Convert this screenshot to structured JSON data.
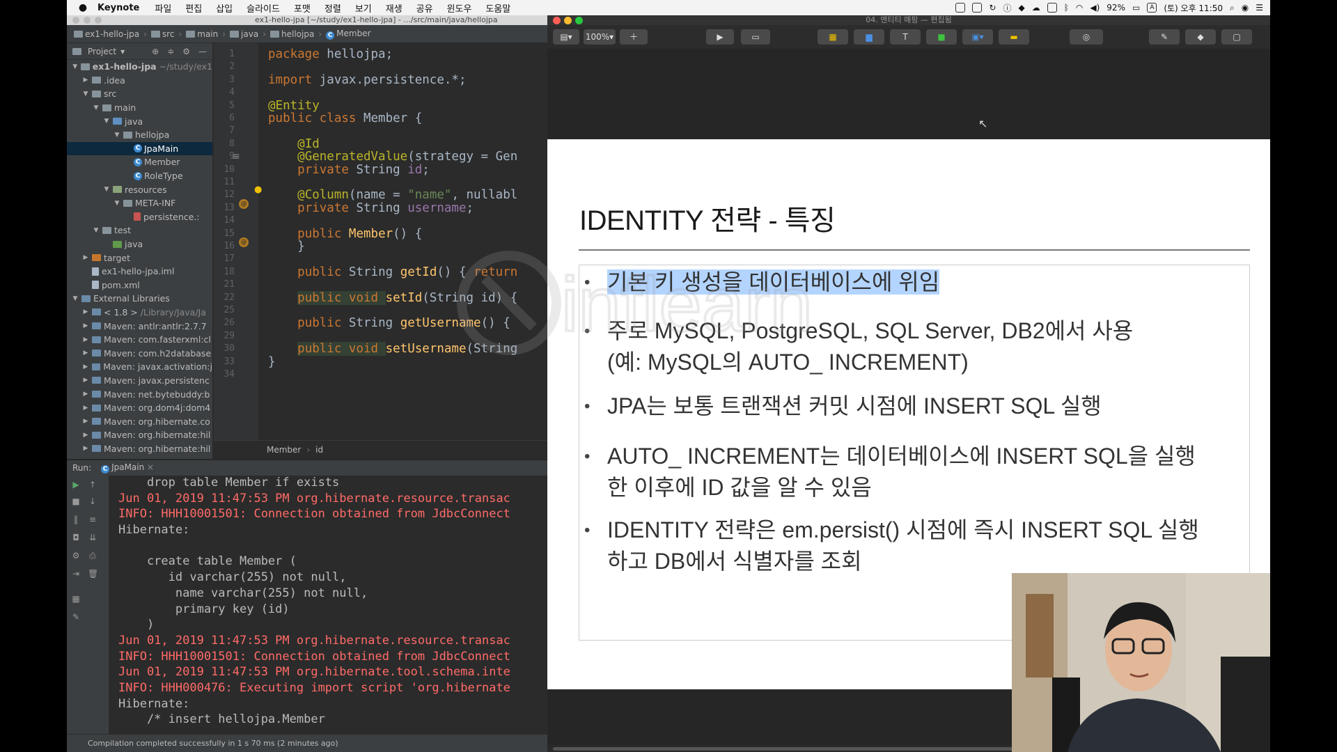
{
  "menubar": {
    "app": "Keynote",
    "items": [
      "파일",
      "편집",
      "삽입",
      "슬라이드",
      "포맷",
      "정렬",
      "보기",
      "재생",
      "공유",
      "윈도우",
      "도움말"
    ],
    "battery": "92%",
    "input_source": "A",
    "clock": "(토) 오후 11:50"
  },
  "ide": {
    "window_title": "ex1-hello-jpa [~/study/ex1-hello-jpa] - .../src/main/java/hellojpa",
    "breadcrumb": [
      "ex1-hello-jpa",
      "src",
      "main",
      "java",
      "hellojpa",
      "Member"
    ],
    "project_label": "Project",
    "tree": [
      {
        "label": "ex1-hello-jpa",
        "extra": "~/study/ex1",
        "indent": 0,
        "arrow": "▼",
        "icon": "blue",
        "bold": true
      },
      {
        "label": ".idea",
        "indent": 1,
        "arrow": "▶",
        "icon": "blue"
      },
      {
        "label": "src",
        "indent": 1,
        "arrow": "▼",
        "icon": "blue"
      },
      {
        "label": "main",
        "indent": 2,
        "arrow": "▼",
        "icon": "blue"
      },
      {
        "label": "java",
        "indent": 3,
        "arrow": "▼",
        "icon": "src"
      },
      {
        "label": "hellojpa",
        "indent": 4,
        "arrow": "▼",
        "icon": "blue"
      },
      {
        "label": "JpaMain",
        "indent": 5,
        "arrow": "",
        "icon": "class",
        "selected": true
      },
      {
        "label": "Member",
        "indent": 5,
        "arrow": "",
        "icon": "class"
      },
      {
        "label": "RoleType",
        "indent": 5,
        "arrow": "",
        "icon": "class"
      },
      {
        "label": "resources",
        "indent": 3,
        "arrow": "▼",
        "icon": "res"
      },
      {
        "label": "META-INF",
        "indent": 4,
        "arrow": "▼",
        "icon": "blue"
      },
      {
        "label": "persistence.:",
        "indent": 5,
        "arrow": "",
        "icon": "xml"
      },
      {
        "label": "test",
        "indent": 2,
        "arrow": "▼",
        "icon": "blue"
      },
      {
        "label": "java",
        "indent": 3,
        "arrow": "",
        "icon": "green"
      },
      {
        "label": "target",
        "indent": 1,
        "arrow": "▶",
        "icon": "orange"
      },
      {
        "label": "ex1-hello-jpa.iml",
        "indent": 1,
        "arrow": "",
        "icon": "file"
      },
      {
        "label": "pom.xml",
        "indent": 1,
        "arrow": "",
        "icon": "file"
      },
      {
        "label": "External Libraries",
        "indent": 0,
        "arrow": "▼",
        "icon": "lib"
      },
      {
        "label": "< 1.8 >",
        "extra": "/Library/Java/Ja",
        "indent": 1,
        "arrow": "▶",
        "icon": "lib"
      },
      {
        "label": "Maven: antlr:antlr:2.7.7",
        "indent": 1,
        "arrow": "▶",
        "icon": "lib"
      },
      {
        "label": "Maven: com.fasterxml:cl",
        "indent": 1,
        "arrow": "▶",
        "icon": "lib"
      },
      {
        "label": "Maven: com.h2database",
        "indent": 1,
        "arrow": "▶",
        "icon": "lib"
      },
      {
        "label": "Maven: javax.activation:j",
        "indent": 1,
        "arrow": "▶",
        "icon": "lib"
      },
      {
        "label": "Maven: javax.persistenc",
        "indent": 1,
        "arrow": "▶",
        "icon": "lib"
      },
      {
        "label": "Maven: net.bytebuddy:b",
        "indent": 1,
        "arrow": "▶",
        "icon": "lib"
      },
      {
        "label": "Maven: org.dom4j:dom4",
        "indent": 1,
        "arrow": "▶",
        "icon": "lib"
      },
      {
        "label": "Maven: org.hibernate.co",
        "indent": 1,
        "arrow": "▶",
        "icon": "lib"
      },
      {
        "label": "Maven: org.hibernate:hil",
        "indent": 1,
        "arrow": "▶",
        "icon": "lib"
      },
      {
        "label": "Maven: org.hibernate:hil",
        "indent": 1,
        "arrow": "▶",
        "icon": "lib"
      }
    ],
    "code_lines": [
      {
        "n": "1",
        "parts": [
          [
            "kw",
            "package "
          ],
          [
            "",
            "hellojpa;"
          ]
        ]
      },
      {
        "n": "2",
        "parts": []
      },
      {
        "n": "3",
        "parts": [
          [
            "kw",
            "import "
          ],
          [
            "",
            "javax.persistence.*;"
          ]
        ]
      },
      {
        "n": "4",
        "parts": []
      },
      {
        "n": "5",
        "parts": [
          [
            "an",
            "@Entity"
          ]
        ]
      },
      {
        "n": "6",
        "parts": [
          [
            "kw",
            "public class "
          ],
          [
            "",
            "Member {"
          ]
        ]
      },
      {
        "n": "7",
        "parts": []
      },
      {
        "n": "8",
        "parts": [
          [
            "",
            "    "
          ],
          [
            "an",
            "@Id"
          ]
        ]
      },
      {
        "n": "9",
        "parts": [
          [
            "",
            "    "
          ],
          [
            "an",
            "@GeneratedValue"
          ],
          [
            "",
            "(strategy = Gen"
          ]
        ]
      },
      {
        "n": "10",
        "parts": [
          [
            "",
            "    "
          ],
          [
            "kw",
            "private "
          ],
          [
            "",
            "String "
          ],
          [
            "fld",
            "id"
          ],
          [
            "",
            ";"
          ]
        ]
      },
      {
        "n": "11",
        "parts": []
      },
      {
        "n": "12",
        "parts": [
          [
            "",
            "    "
          ],
          [
            "an",
            "@Column"
          ],
          [
            "",
            "(name = "
          ],
          [
            "str",
            "\"name\""
          ],
          [
            "",
            ", nullabl"
          ]
        ]
      },
      {
        "n": "13",
        "parts": [
          [
            "",
            "    "
          ],
          [
            "kw",
            "private "
          ],
          [
            "",
            "String "
          ],
          [
            "fld",
            "username"
          ],
          [
            "",
            ";"
          ]
        ]
      },
      {
        "n": "14",
        "parts": []
      },
      {
        "n": "15",
        "parts": [
          [
            "",
            "    "
          ],
          [
            "kw",
            "public "
          ],
          [
            "fn",
            "Member"
          ],
          [
            "",
            "() {"
          ]
        ]
      },
      {
        "n": "16",
        "parts": [
          [
            "",
            "    }"
          ]
        ]
      },
      {
        "n": "17",
        "parts": []
      },
      {
        "n": "18",
        "parts": [
          [
            "",
            "    "
          ],
          [
            "kw",
            "public "
          ],
          [
            "",
            "String "
          ],
          [
            "fn",
            "getId"
          ],
          [
            "",
            "() { "
          ],
          [
            "kw",
            "return"
          ]
        ]
      },
      {
        "n": "21",
        "parts": []
      },
      {
        "n": "22",
        "parts": [
          [
            "",
            "    "
          ],
          [
            "kw",
            "public "
          ],
          [
            "kw",
            "void "
          ],
          [
            "fn",
            "setId"
          ],
          [
            "",
            "(String id) {"
          ]
        ]
      },
      {
        "n": "25",
        "parts": []
      },
      {
        "n": "26",
        "parts": [
          [
            "",
            "    "
          ],
          [
            "kw",
            "public "
          ],
          [
            "",
            "String "
          ],
          [
            "fn",
            "getUsername"
          ],
          [
            "",
            "() {"
          ]
        ]
      },
      {
        "n": "29",
        "parts": []
      },
      {
        "n": "30",
        "parts": [
          [
            "",
            "    "
          ],
          [
            "kw",
            "public "
          ],
          [
            "kw",
            "void "
          ],
          [
            "fn",
            "setUsername"
          ],
          [
            "",
            "(String"
          ]
        ]
      },
      {
        "n": "33",
        "parts": [
          [
            "",
            "}"
          ]
        ]
      },
      {
        "n": "34",
        "parts": []
      }
    ],
    "editor_crumb": [
      "Member",
      "id"
    ],
    "run_label": "Run:",
    "run_tab": "JpaMain",
    "console": [
      {
        "t": "    drop table Member if exists",
        "red": false
      },
      {
        "t": "Jun 01, 2019 11:47:53 PM org.hibernate.resource.transac",
        "red": true
      },
      {
        "t": "INFO: HHH10001501: Connection obtained from JdbcConnect",
        "red": true
      },
      {
        "t": "Hibernate:",
        "red": false
      },
      {
        "t": "",
        "red": false
      },
      {
        "t": "    create table Member (",
        "red": false
      },
      {
        "t": "       id varchar(255) not null,",
        "red": false
      },
      {
        "t": "        name varchar(255) not null,",
        "red": false
      },
      {
        "t": "        primary key (id)",
        "red": false
      },
      {
        "t": "    )",
        "red": false
      },
      {
        "t": "Jun 01, 2019 11:47:53 PM org.hibernate.resource.transac",
        "red": true
      },
      {
        "t": "INFO: HHH10001501: Connection obtained from JdbcConnect",
        "red": true
      },
      {
        "t": "Jun 01, 2019 11:47:53 PM org.hibernate.tool.schema.inte",
        "red": true
      },
      {
        "t": "INFO: HHH000476: Executing import script 'org.hibernate",
        "red": true
      },
      {
        "t": "Hibernate:",
        "red": false
      },
      {
        "t": "    /* insert hellojpa.Member",
        "red": false
      }
    ],
    "status": "Compilation completed successfully in 1 s 70 ms (2 minutes ago)"
  },
  "keynote": {
    "window_title": "04. 엔티티 매핑 — 편집됨",
    "zoom": "100%",
    "slide_title": "IDENTITY 전략 - 특징",
    "bullets": [
      {
        "lines": [
          "기본 키 생성을 데이터베이스에 위임"
        ],
        "highlight": true
      },
      {
        "lines": [
          "주로 MySQL, PostgreSQL, SQL Server, DB2에서 사용",
          "(예: MySQL의 AUTO_ INCREMENT)"
        ],
        "highlight": false
      },
      {
        "lines": [
          "JPA는 보통 트랜잭션 커밋 시점에 INSERT SQL 실행"
        ],
        "highlight": false
      },
      {
        "lines": [
          "AUTO_ INCREMENT는 데이터베이스에 INSERT SQL을 실행",
          "한 이후에 ID 값을 알 수 있음"
        ],
        "highlight": false
      },
      {
        "lines": [
          "IDENTITY 전략은 em.persist() 시점에 즉시 INSERT SQL 실행",
          "하고 DB에서 식별자를 조회"
        ],
        "highlight": false
      }
    ]
  }
}
